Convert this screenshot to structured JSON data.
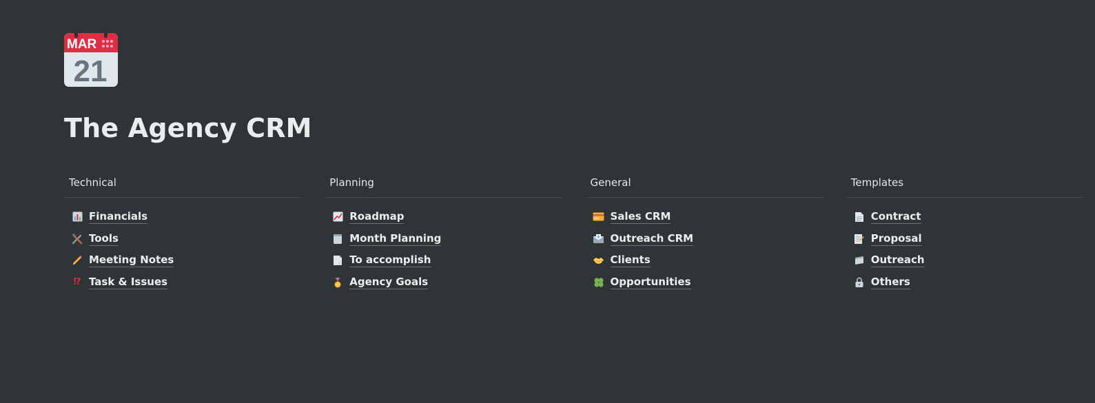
{
  "page": {
    "icon_month": "MAR",
    "icon_day": "21",
    "title": "The Agency CRM"
  },
  "columns": [
    {
      "header": "Technical",
      "links": [
        {
          "label": "Financials",
          "icon": "bar-chart-icon"
        },
        {
          "label": "Tools",
          "icon": "hammer-wrench-icon"
        },
        {
          "label": "Meeting Notes",
          "icon": "pencil-icon"
        },
        {
          "label": "Task & Issues",
          "icon": "interrobang-icon"
        }
      ]
    },
    {
      "header": "Planning",
      "links": [
        {
          "label": "Roadmap",
          "icon": "trending-chart-icon"
        },
        {
          "label": "Month Planning",
          "icon": "notepad-icon"
        },
        {
          "label": "To accomplish",
          "icon": "page-icon"
        },
        {
          "label": "Agency Goals",
          "icon": "medal-icon"
        }
      ]
    },
    {
      "header": "General",
      "links": [
        {
          "label": "Sales CRM",
          "icon": "credit-card-icon"
        },
        {
          "label": "Outreach CRM",
          "icon": "envelope-icon"
        },
        {
          "label": "Clients",
          "icon": "handshake-icon"
        },
        {
          "label": "Opportunities",
          "icon": "clover-icon"
        }
      ]
    },
    {
      "header": "Templates",
      "links": [
        {
          "label": "Contract",
          "icon": "document-icon"
        },
        {
          "label": "Proposal",
          "icon": "memo-icon"
        },
        {
          "label": "Outreach",
          "icon": "bookmark-icon"
        },
        {
          "label": "Others",
          "icon": "lock-icon"
        }
      ]
    }
  ],
  "colors": {
    "background": "#2f3437",
    "calendar_red": "#dd2e44",
    "calendar_body": "#e1e8ed",
    "text": "#ebeced"
  }
}
